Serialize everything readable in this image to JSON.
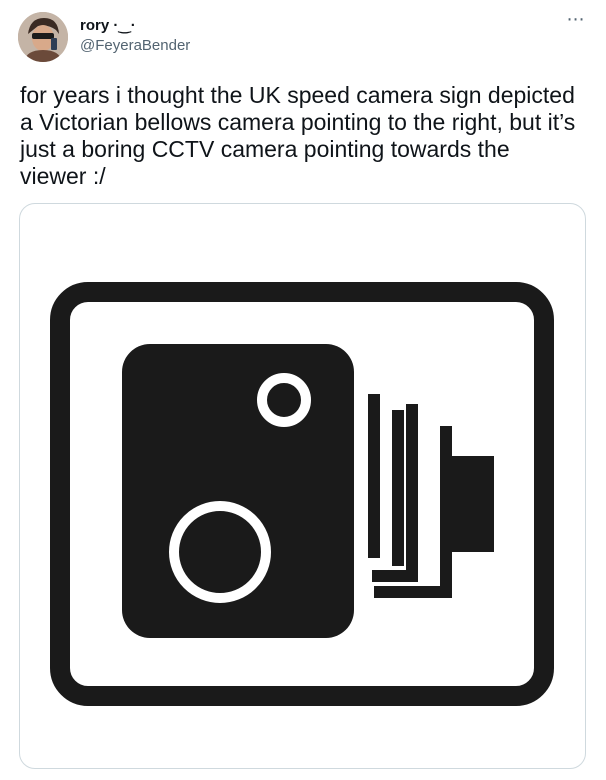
{
  "tweet": {
    "display_name": "rory ·‿·",
    "handle": "@FeyeraBender",
    "text": "for years i thought the UK speed camera sign depicted a Victorian bellows camera pointing to the right, but it’s just a boring CCTV camera pointing towards the viewer :/",
    "more_icon": "more-horizontal-icon"
  },
  "avatar": {
    "icon": "user-avatar-photo"
  },
  "media": {
    "icon": "speed-camera-sign",
    "colors": {
      "sign_fg": "#1a1a1a",
      "sign_bg": "#ffffff"
    }
  },
  "colors": {
    "text": "#0f1419",
    "secondary": "#536471",
    "border": "#cfd9de"
  }
}
